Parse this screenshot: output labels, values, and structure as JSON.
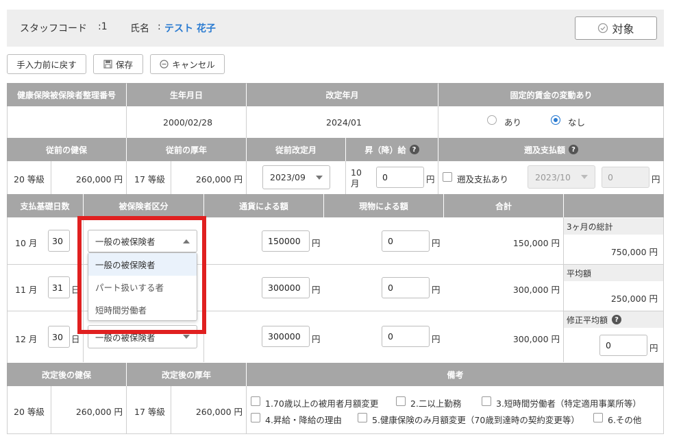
{
  "header": {
    "staff_code_label": "スタッフコード",
    "staff_code_value": ":1",
    "name_label": "氏名",
    "name_sep": ":",
    "name_value": "テスト 花子",
    "target_button": "対象"
  },
  "toolbar": {
    "revert_label": "手入力前に戻す",
    "save_label": "保存",
    "cancel_label": "キャンセル"
  },
  "section1": {
    "headers": [
      "健康保険被保険者整理番号",
      "生年月日",
      "改定年月",
      "固定的賃金の変動あり"
    ],
    "insured_number": "",
    "birth_date": "2000/02/28",
    "revision_month": "2024/01",
    "radio_yes": "あり",
    "radio_no": "なし",
    "selected": "なし"
  },
  "section2": {
    "headers": [
      "従前の健保",
      "従前の厚年",
      "従前改定月",
      "昇（降）給",
      "遡及支払額"
    ],
    "prev_health_grade": "20 等級",
    "prev_health_amount": "260,000 円",
    "prev_pension_grade": "17 等級",
    "prev_pension_amount": "260,000 円",
    "prev_revision_month": "2023/09",
    "raise_month": "10 月",
    "raise_value": "0",
    "yen": "円",
    "retro_checkbox_label": "遡及支払あり",
    "retro_month": "2023/10",
    "retro_amount": "0"
  },
  "section3": {
    "headers": [
      "支払基礎日数",
      "被保険者区分",
      "通貨による額",
      "現物による額",
      "合計"
    ],
    "day_unit": "日",
    "rows": [
      {
        "month": "10 月",
        "days": "30",
        "category": "一般の被保険者",
        "cash": "150000",
        "kind": "0",
        "total": "150,000 円"
      },
      {
        "month": "11 月",
        "days": "31",
        "category": "",
        "cash": "300000",
        "kind": "0",
        "total": "300,000 円"
      },
      {
        "month": "12 月",
        "days": "30",
        "category": "一般の被保険者",
        "cash": "300000",
        "kind": "0",
        "total": "300,000 円"
      }
    ],
    "dropdown_options": [
      "一般の被保険者",
      "パート扱いする者",
      "短時間労働者"
    ],
    "summary": {
      "three_month_total_label": "3ヶ月の総計",
      "three_month_total": "750,000 円",
      "average_label": "平均額",
      "average": "250,000 円",
      "adjusted_average_label": "修正平均額",
      "adjusted_average": "0"
    }
  },
  "section4": {
    "headers": [
      "改定後の健保",
      "改定後の厚年",
      "備考"
    ],
    "new_health_grade": "20 等級",
    "new_health_amount": "260,000 円",
    "new_pension_grade": "17 等級",
    "new_pension_amount": "260,000 円",
    "remarks": [
      "1.70歳以上の被用者月額変更",
      "2.二以上勤務",
      "3.短時間労働者（特定適用事業所等）",
      "4.昇給・降給の理由",
      "5.健康保険のみ月額変更（70歳到達時の契約変更等）",
      "6.その他"
    ]
  },
  "colors": {
    "header_gray": "#a6a6a6",
    "accent_blue": "#2a7bd1",
    "highlight_red": "#e02020"
  }
}
